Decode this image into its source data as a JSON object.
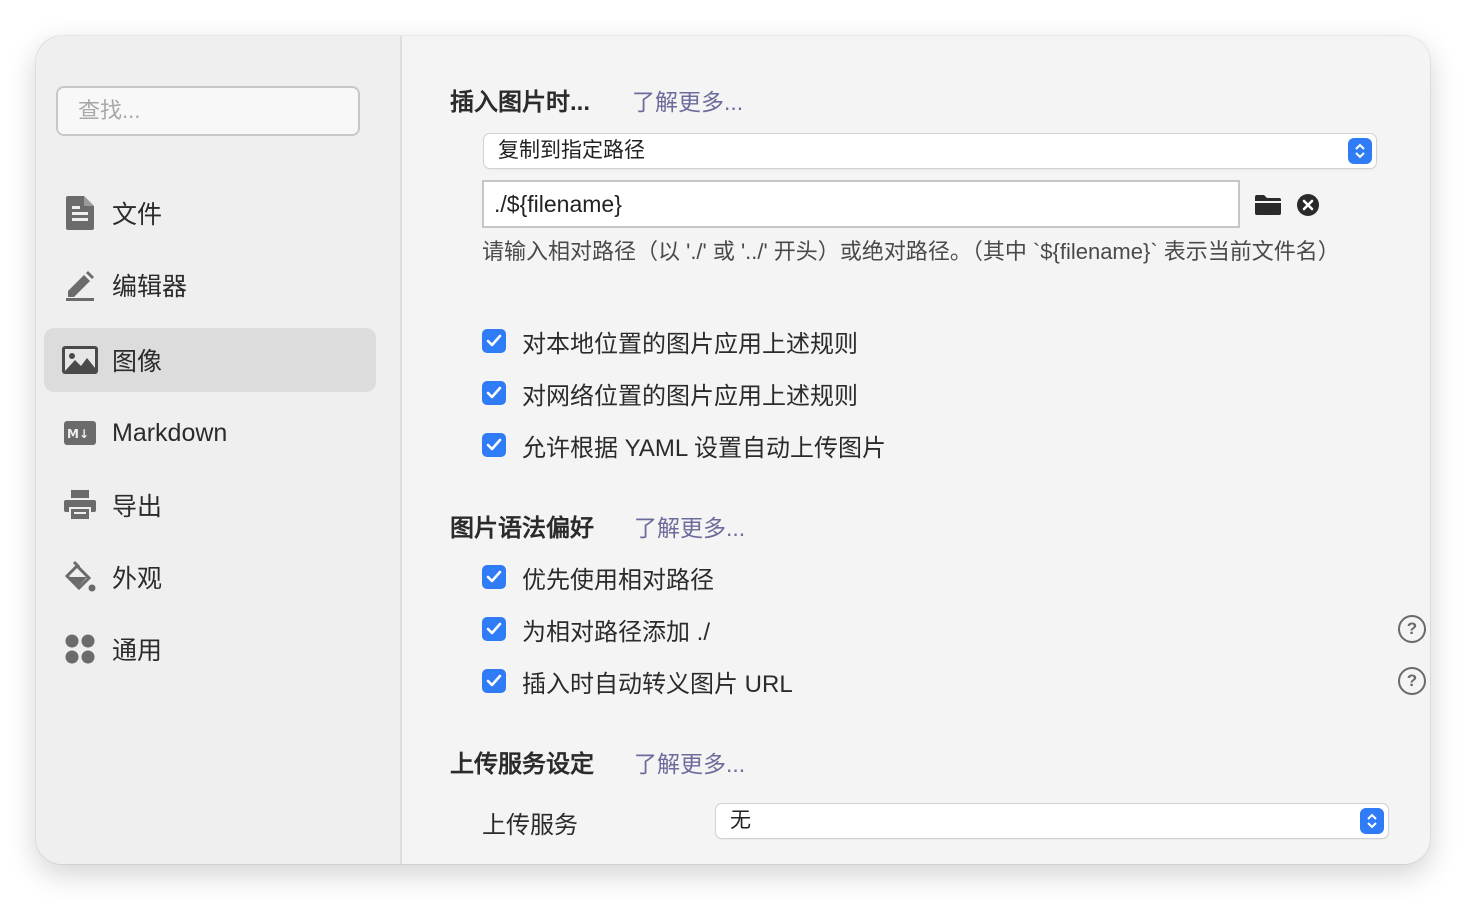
{
  "sidebar": {
    "search_placeholder": "查找...",
    "items": [
      {
        "label": "文件",
        "icon": "document-icon"
      },
      {
        "label": "编辑器",
        "icon": "pencil-icon"
      },
      {
        "label": "图像",
        "icon": "image-icon",
        "active": true
      },
      {
        "label": "Markdown",
        "icon": "markdown-icon"
      },
      {
        "label": "导出",
        "icon": "printer-icon"
      },
      {
        "label": "外观",
        "icon": "paint-bucket-icon"
      },
      {
        "label": "通用",
        "icon": "grid-dots-icon"
      }
    ]
  },
  "insert_image": {
    "title": "插入图片时...",
    "learn_more": "了解更多...",
    "action_selected": "复制到指定路径",
    "path_value": "./${filename}",
    "hint": "请输入相对路径（以 './' 或 '../' 开头）或绝对路径。（其中 `${filename}` 表示当前文件名）",
    "options": [
      {
        "label": "对本地位置的图片应用上述规则",
        "checked": true
      },
      {
        "label": "对网络位置的图片应用上述规则",
        "checked": true
      },
      {
        "label": "允许根据 YAML 设置自动上传图片",
        "checked": true
      }
    ]
  },
  "syntax_pref": {
    "title": "图片语法偏好",
    "learn_more": "了解更多...",
    "options": [
      {
        "label": "优先使用相对路径",
        "checked": true
      },
      {
        "label": "为相对路径添加 ./",
        "checked": true
      },
      {
        "label": "插入时自动转义图片 URL",
        "checked": true
      }
    ]
  },
  "upload": {
    "title": "上传服务设定",
    "learn_more": "了解更多...",
    "service_label": "上传服务",
    "service_selected": "无"
  },
  "colors": {
    "accent": "#2f7cf6",
    "link": "#6c6c9c",
    "close_button": "#ee5f57"
  }
}
